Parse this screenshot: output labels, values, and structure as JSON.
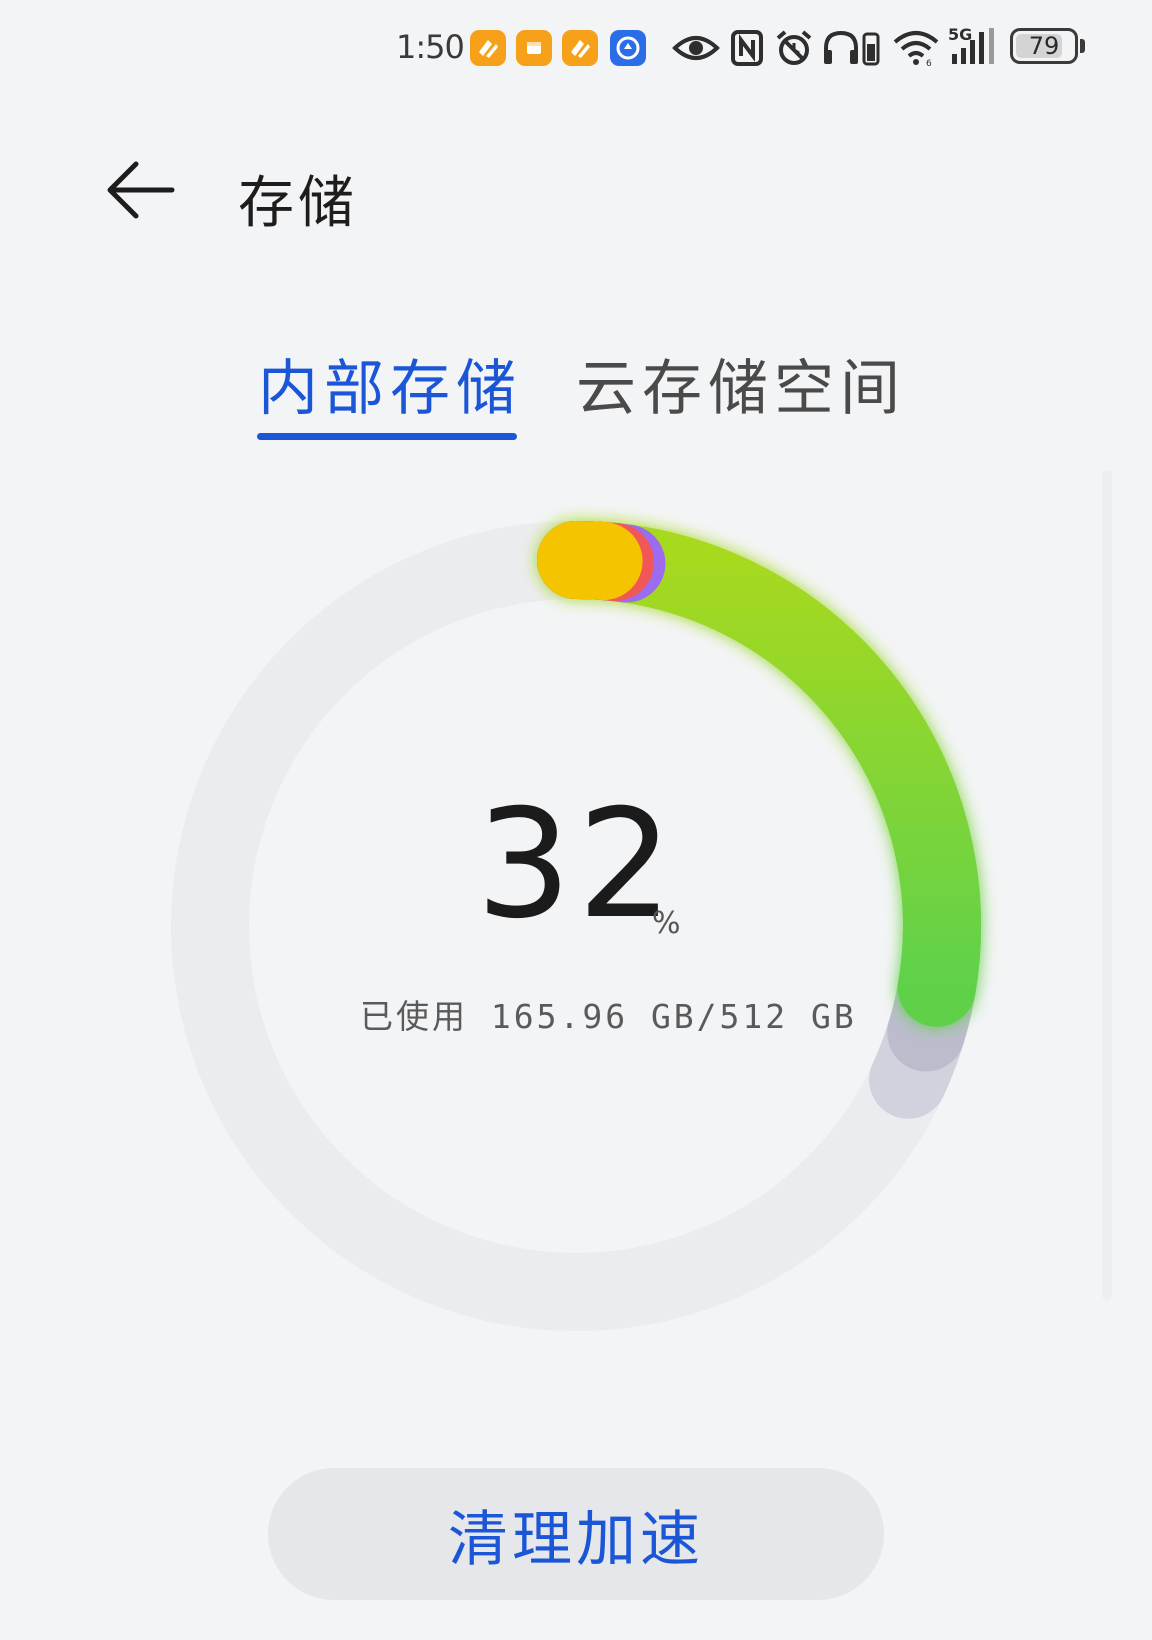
{
  "status_bar": {
    "time": "1:50",
    "battery_level": "79",
    "network_label": "5G",
    "notification_icons": [
      "orange-app-icon",
      "orange-square-app-icon",
      "orange-app-icon",
      "blue-app-icon"
    ],
    "system_icons": [
      "eye-icon",
      "nfc-icon",
      "alarm-icon",
      "headphones-icon",
      "wifi-icon",
      "signal-icon",
      "battery-icon"
    ]
  },
  "header": {
    "title": "存储"
  },
  "tabs": [
    {
      "label": "内部存储",
      "active": true
    },
    {
      "label": "云存储空间",
      "active": false
    }
  ],
  "storage": {
    "percent": "32",
    "percent_unit": "%",
    "usage_text": "已使用 165.96 GB/512 GB",
    "used_gb": 165.96,
    "total_gb": 512,
    "segments": [
      {
        "category": "yellow",
        "color": "#f5c400",
        "fraction": 0.012
      },
      {
        "category": "red",
        "color": "#f25757",
        "fraction": 0.005
      },
      {
        "category": "purple",
        "color": "#9b6cf0",
        "fraction": 0.005
      },
      {
        "category": "green",
        "color": "#8fd22a",
        "fraction": 0.255
      },
      {
        "category": "gray",
        "color": "#bcbccc",
        "fraction": 0.02
      },
      {
        "category": "light-gray",
        "color": "#d2d2de",
        "fraction": 0.022
      }
    ],
    "track_color": "#ebecef"
  },
  "actions": {
    "clean_label": "清理加速"
  },
  "colors": {
    "accent": "#1a56d6",
    "background": "#f3f4f6"
  }
}
